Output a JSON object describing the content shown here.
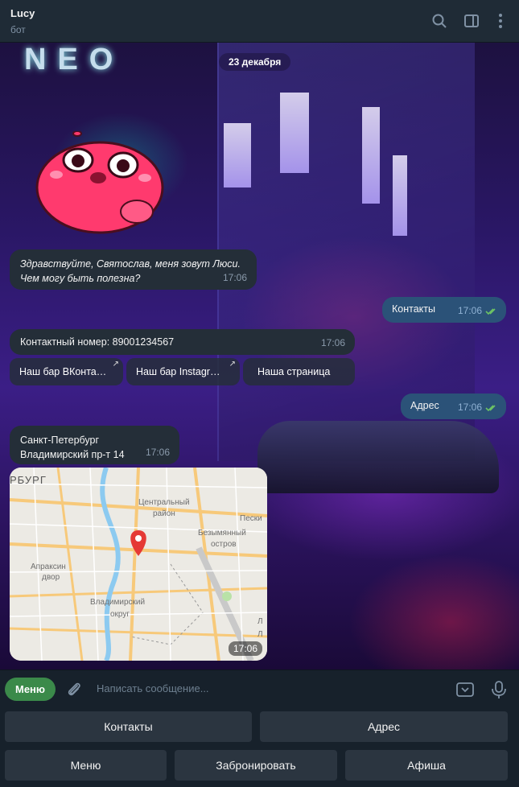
{
  "header": {
    "title": "Lucy",
    "subtitle": "бот"
  },
  "chat": {
    "date": "23 декабря",
    "messages": [
      {
        "text_line1": "Здравствуйте, Святослав, меня зовут Люси.",
        "text_line2": "Чем могу быть полезна?",
        "time": "17:06"
      },
      {
        "text": "Контакты",
        "time": "17:06"
      },
      {
        "text": "Контактный номер: 89001234567",
        "time": "17:06"
      },
      {
        "text": "Адрес",
        "time": "17:06"
      },
      {
        "text_line1": "Санкт-Петербург",
        "text_line2": "Владимирский пр-т 14",
        "time": "17:06"
      }
    ],
    "inline_buttons": [
      {
        "label": "Наш бар ВКонта…"
      },
      {
        "label": "Наш бар Instagr…"
      },
      {
        "label": "Наша страница"
      }
    ],
    "map": {
      "time": "17:06",
      "labels": [
        "РБУРГ",
        "Центральный",
        "район",
        "Пески",
        "Безымянный",
        "остров",
        "Апраксин",
        "двор",
        "Владимирский",
        "округ",
        "Л",
        "Л"
      ]
    }
  },
  "input": {
    "menu_label": "Меню",
    "placeholder": "Написать сообщение..."
  },
  "keyboard": {
    "rows": [
      [
        "Контакты",
        "Адрес"
      ],
      [
        "Меню",
        "Забронировать",
        "Афиша"
      ]
    ]
  },
  "colors": {
    "menu_button": "#3b8a4a",
    "outgoing_bubble": "#2b5278",
    "incoming_bubble": "#242e38",
    "map_pin": "#e53935"
  }
}
